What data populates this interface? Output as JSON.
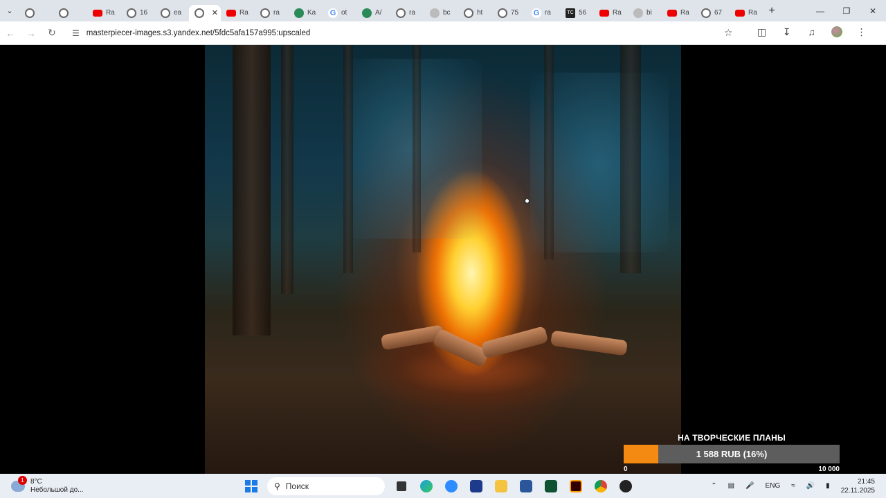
{
  "browser": {
    "tabs": [
      {
        "label": "",
        "icon": "globe"
      },
      {
        "label": "",
        "icon": "globe"
      },
      {
        "label": "Ra",
        "icon": "youtube"
      },
      {
        "label": "16",
        "icon": "globe"
      },
      {
        "label": "ea",
        "icon": "globe"
      },
      {
        "label": "",
        "icon": "globe",
        "active": true
      },
      {
        "label": "Ra",
        "icon": "youtube"
      },
      {
        "label": "ra",
        "icon": "globe"
      },
      {
        "label": "Ka",
        "icon": "kinopoisk"
      },
      {
        "label": "ot",
        "icon": "google"
      },
      {
        "label": "A/",
        "icon": "kinopoisk"
      },
      {
        "label": "ra",
        "icon": "globe"
      },
      {
        "label": "bc",
        "icon": "grey"
      },
      {
        "label": "ht",
        "icon": "globe"
      },
      {
        "label": "75",
        "icon": "globe"
      },
      {
        "label": "ra",
        "icon": "google"
      },
      {
        "label": "56",
        "icon": "tc"
      },
      {
        "label": "Ra",
        "icon": "youtube"
      },
      {
        "label": "bi",
        "icon": "people"
      },
      {
        "label": "Ra",
        "icon": "youtube"
      },
      {
        "label": "67",
        "icon": "globe"
      },
      {
        "label": "Ra",
        "icon": "youtube"
      }
    ],
    "url": "masterpiecer-images.s3.yandex.net/5fdc5afa157a995:upscaled"
  },
  "donation": {
    "title": "НА ТВОРЧЕСКИЕ ПЛАНЫ",
    "amount_text": "1 588 RUB (16%)",
    "progress": 0.16,
    "min": "0",
    "max": "10 000",
    "accent": "#f58a12"
  },
  "taskbar": {
    "weather_temp": "8°C",
    "weather_desc": "Небольшой до...",
    "weather_badge": "1",
    "search_placeholder": "Поиск",
    "language": "ENG",
    "time": "21:45",
    "date": "22.11.2025"
  }
}
